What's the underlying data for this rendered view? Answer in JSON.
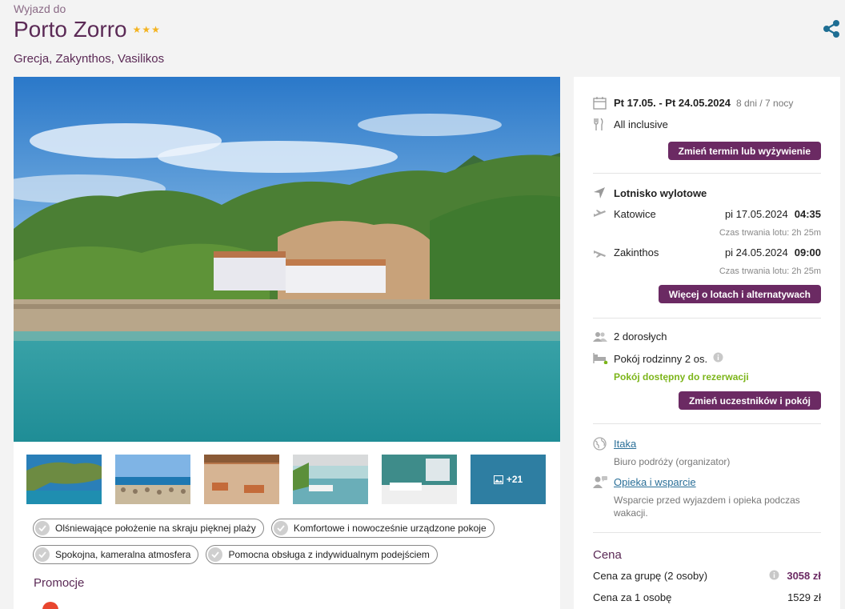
{
  "header": {
    "pre_title": "Wyjazd do",
    "title": "Porto Zorro",
    "stars": "★★★",
    "location": "Grecja, Zakynthos, Vasilikos"
  },
  "gallery": {
    "more_label": "+21"
  },
  "features": [
    "Olśniewające położenie na skraju pięknej plaży",
    "Komfortowe i nowocześnie urządzone pokoje",
    "Spokojna, kameralna atmosfera",
    "Pomocna obsługa z indywidualnym podejściem"
  ],
  "promotions": {
    "title": "Promocje"
  },
  "booking": {
    "dates": "Pt 17.05. - Pt 24.05.2024",
    "duration": "8 dni / 7 nocy",
    "board": "All inclusive",
    "change_date_button": "Zmień termin lub wyżywienie",
    "airport_label": "Lotnisko wylotowe",
    "outbound": {
      "city": "Katowice",
      "date": "pi 17.05.2024",
      "time": "04:35",
      "duration": "Czas trwania lotu: 2h 25m"
    },
    "return": {
      "city": "Zakinthos",
      "date": "pi 24.05.2024",
      "time": "09:00",
      "duration": "Czas trwania lotu: 2h 25m"
    },
    "flights_button": "Więcej o lotach i alternatywach",
    "travelers": "2 dorosłych",
    "room": "Pokój rodzinny 2 os.",
    "room_status": "Pokój dostępny do rezerwacji",
    "change_participants_button": "Zmień uczestników i pokój",
    "organizer_link": "Itaka",
    "organizer_desc": "Biuro podróży (organizator)",
    "support_link": "Opieka i wsparcie",
    "support_desc_1": "Wsparcie przed wyjazdem i opieka podczas",
    "support_desc_2": "wakacji.",
    "price_title": "Cena",
    "group_price_label": "Cena za grupę (2 osoby)",
    "group_price": "3058 zł",
    "person_price_label": "Cena za 1 osobę",
    "person_price": "1529 zł"
  },
  "colors": {
    "brand": "#6b2a63",
    "title": "#5b2a56",
    "available": "#7cb51a",
    "link": "#2a6f98"
  }
}
